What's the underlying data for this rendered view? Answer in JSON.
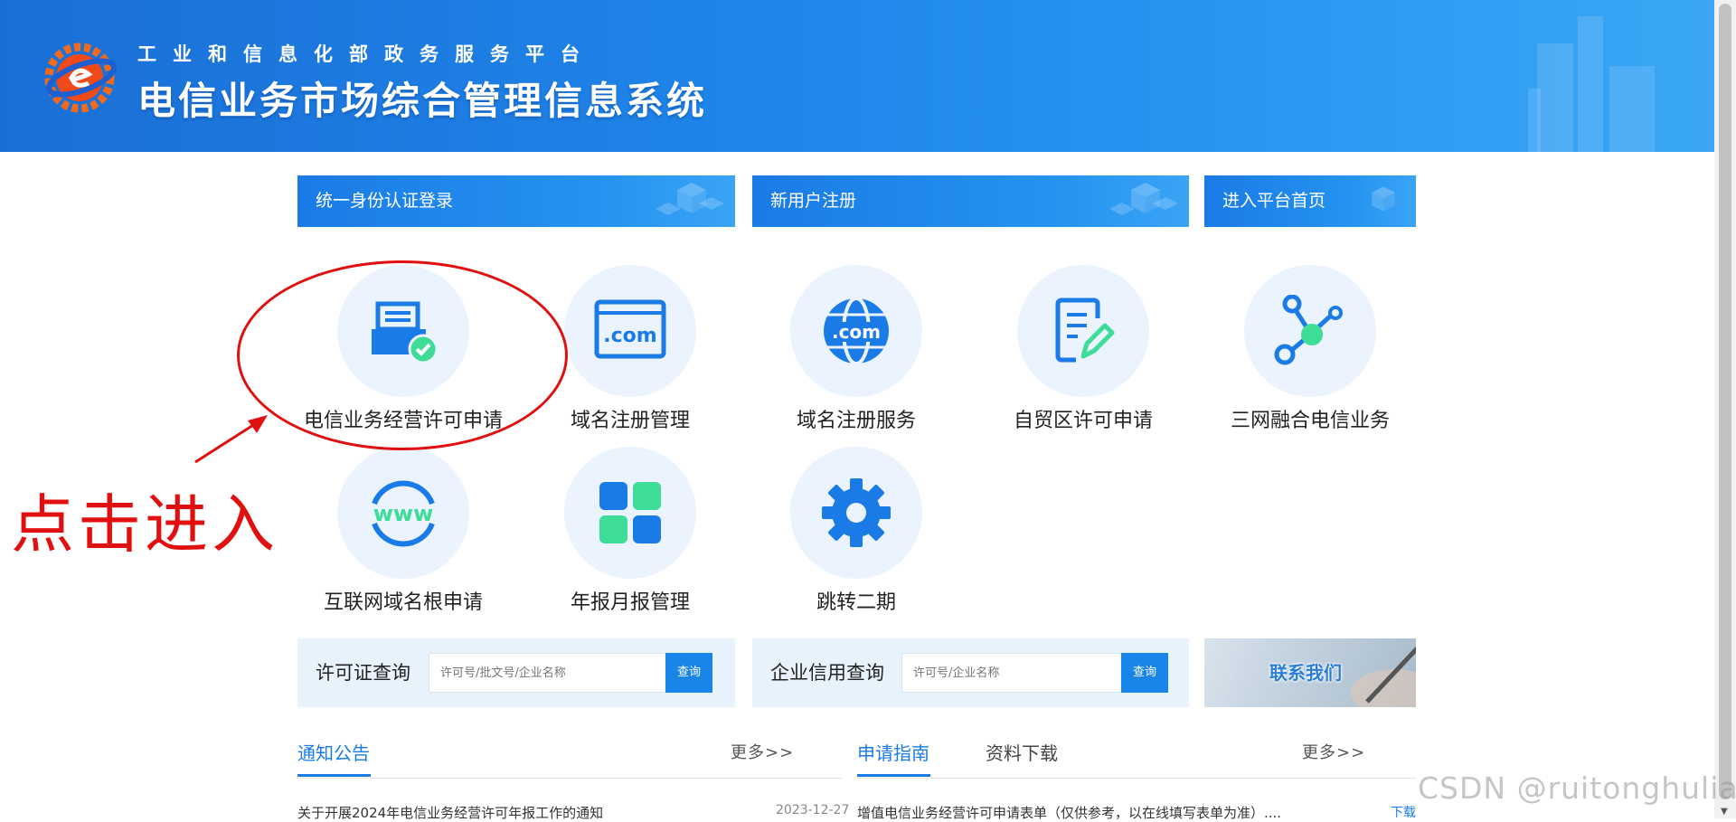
{
  "header": {
    "sub_title": "工业和信息化部政务服务平台",
    "main_title": "电信业务市场综合管理信息系统"
  },
  "nav": {
    "login": "统一身份认证登录",
    "register": "新用户注册",
    "home": "进入平台首页"
  },
  "services": [
    {
      "label": "电信业务经营许可申请",
      "icon": "license-document-icon"
    },
    {
      "label": "域名注册管理",
      "icon": "dotcom-window-icon"
    },
    {
      "label": "域名注册服务",
      "icon": "dotcom-globe-icon"
    },
    {
      "label": "自贸区许可申请",
      "icon": "edit-document-icon"
    },
    {
      "label": "三网融合电信业务",
      "icon": "network-nodes-icon"
    },
    {
      "label": "互联网域名根申请",
      "icon": "www-icon"
    },
    {
      "label": "年报月报管理",
      "icon": "grid-blocks-icon"
    },
    {
      "label": "跳转二期",
      "icon": "gear-icon"
    }
  ],
  "annotation": {
    "text": "点击进入"
  },
  "license_query": {
    "label": "许可证查询",
    "placeholder": "许可号/批文号/企业名称",
    "button": "查询"
  },
  "credit_query": {
    "label": "企业信用查询",
    "placeholder": "许可号/企业名称",
    "button": "查询"
  },
  "contact": {
    "label": "联系我们"
  },
  "notices": {
    "tab": "通知公告",
    "more": "更多>>",
    "items": [
      {
        "title": "关于开展2024年电信业务经营许可年报工作的通知",
        "date": "2023-12-27"
      }
    ]
  },
  "guide": {
    "tab_active": "申请指南",
    "tab_other": "资料下载",
    "more": "更多>>",
    "items": [
      {
        "title": "增值电信业务经营许可申请表单（仅供参考，以在线填写表单为准）....",
        "action": "下载"
      }
    ]
  },
  "watermark": "CSDN @ruitonghulian",
  "colors": {
    "primary": "#1a7be6",
    "icon_bg": "#eaf3fe",
    "annotation": "#e01010",
    "accent_green": "#3ddc97"
  }
}
